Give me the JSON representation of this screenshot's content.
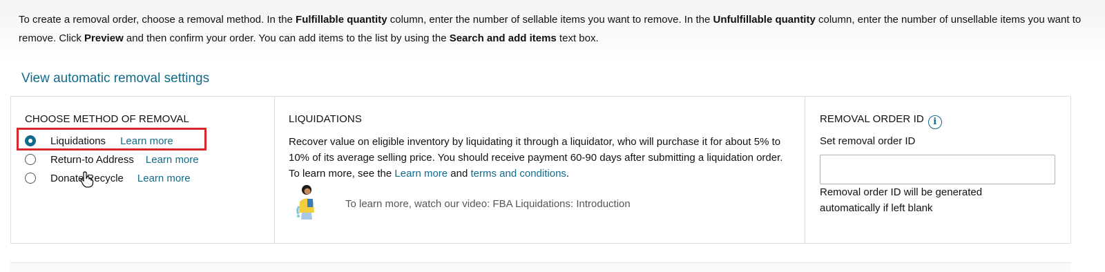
{
  "instructions": {
    "p1": "To create a removal order, choose a removal method. In the ",
    "b1": "Fulfillable quantity",
    "p2": " column, enter the number of sellable items you want to remove. In the ",
    "b2": "Unfulfillable quantity",
    "p3": " column, enter the number of unsellable items you want to remove. Click ",
    "b3": "Preview",
    "p4": " and then confirm your order. You can add items to the list by using the ",
    "b4": "Search and add items",
    "p5": " text box."
  },
  "view_auto_link": "View automatic removal settings",
  "method": {
    "title": "CHOOSE METHOD OF REMOVAL",
    "options": [
      {
        "label": "Liquidations",
        "learn": "Learn more",
        "checked": true
      },
      {
        "label": "Return-to Address",
        "learn": "Learn more",
        "checked": false
      },
      {
        "label": "Donate/Recycle",
        "learn": "Learn more",
        "checked": false
      }
    ]
  },
  "liquidations": {
    "title": "LIQUIDATIONS",
    "t1": "Recover value on eligible inventory by liquidating it through a liquidator, who will purchase it for about 5% to 10% of its average selling price. You should receive payment 60-90 days after submitting a liquidation order. To learn more, see the ",
    "link1": "Learn more",
    "t2": " and ",
    "link2": "terms and conditions",
    "t3": ".",
    "video_text": "To learn more, watch our video: FBA Liquidations: Introduction"
  },
  "removal_id": {
    "title": "REMOVAL ORDER ID",
    "info_glyph": "i",
    "field_label": "Set removal order ID",
    "value": "",
    "hint": "Removal order ID will be generated automatically if left blank"
  },
  "colors": {
    "accent": "#0f6b8a",
    "highlight": "#d9262a",
    "border": "#dddddd"
  }
}
